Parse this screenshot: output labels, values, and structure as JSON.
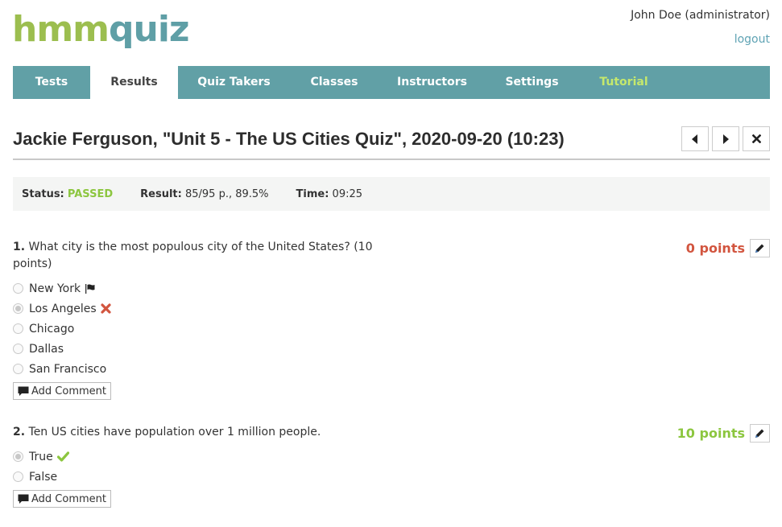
{
  "logo": {
    "part1": "hmm",
    "part2": "quiz"
  },
  "header": {
    "user": "John Doe (administrator)",
    "logout": "logout"
  },
  "nav": {
    "tabs": [
      {
        "label": "Tests",
        "active": false
      },
      {
        "label": "Results",
        "active": true
      },
      {
        "label": "Quiz Takers",
        "active": false
      },
      {
        "label": "Classes",
        "active": false
      },
      {
        "label": "Instructors",
        "active": false
      },
      {
        "label": "Settings",
        "active": false
      },
      {
        "label": "Tutorial",
        "active": false
      }
    ]
  },
  "page": {
    "title": "Jackie Ferguson, \"Unit 5 - The US Cities Quiz\", 2020-09-20 (10:23)",
    "buttons": {
      "prev": "caret-left-icon",
      "next": "caret-right-icon",
      "close": "close-icon"
    }
  },
  "summary": {
    "status_label": "Status:",
    "status_value": "PASSED",
    "result_label": "Result:",
    "result_value": "85/95 p., 89.5%",
    "time_label": "Time:",
    "time_value": "09:25"
  },
  "questions": [
    {
      "number": "1.",
      "text": "What city is the most populous city of the United States? (10 points)",
      "points": "0 points",
      "options": [
        {
          "label": "New York",
          "selected": false,
          "mark": "flag"
        },
        {
          "label": "Los Angeles",
          "selected": true,
          "mark": "wrong"
        },
        {
          "label": "Chicago",
          "selected": false,
          "mark": ""
        },
        {
          "label": "Dallas",
          "selected": false,
          "mark": ""
        },
        {
          "label": "San Francisco",
          "selected": false,
          "mark": ""
        }
      ],
      "comment_label": "Add Comment"
    },
    {
      "number": "2.",
      "text": "Ten US cities have population over 1 million people.",
      "points": "10 points",
      "options": [
        {
          "label": "True",
          "selected": true,
          "mark": "correct"
        },
        {
          "label": "False",
          "selected": false,
          "mark": ""
        }
      ],
      "comment_label": "Add Comment"
    }
  ],
  "colors": {
    "brand_green": "#9cbe4f",
    "brand_teal": "#5f9fa6",
    "nav_bg": "#61a0a6",
    "passed": "#8cc63f",
    "wrong": "#d2553f"
  }
}
